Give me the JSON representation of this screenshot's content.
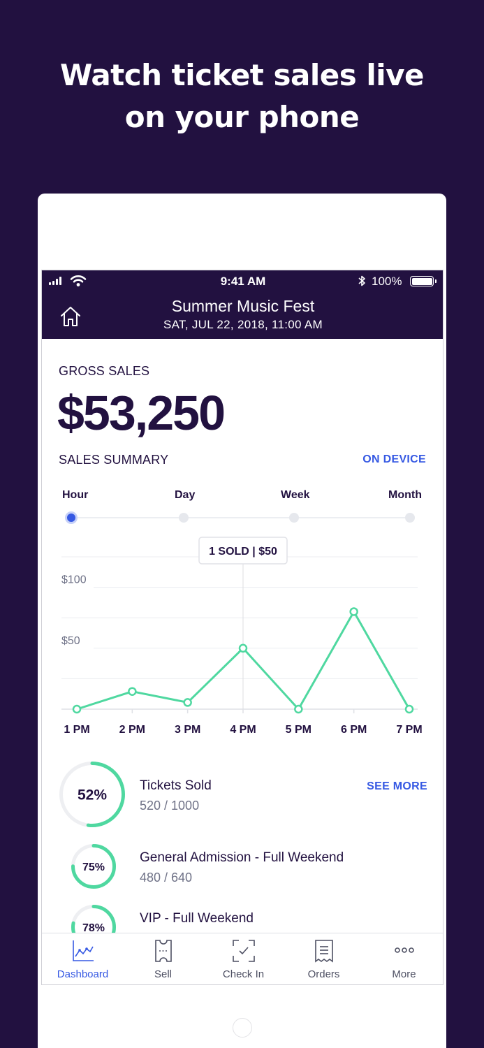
{
  "headline": {
    "line1": "Watch ticket sales live",
    "line2": "on your phone"
  },
  "status_bar": {
    "time": "9:41 AM",
    "battery": "100%"
  },
  "header": {
    "title": "Summer Music Fest",
    "date": "SAT, JUL 22, 2018, 11:00 AM"
  },
  "gross": {
    "label": "GROSS SALES",
    "value": "$53,250"
  },
  "summary": {
    "label": "SALES SUMMARY",
    "action": "ON DEVICE"
  },
  "ranges": [
    "Hour",
    "Day",
    "Week",
    "Month"
  ],
  "selected_range": "Hour",
  "tooltip": "1 SOLD | $50",
  "chart_data": {
    "type": "line",
    "categories": [
      "1 PM",
      "2 PM",
      "3 PM",
      "4 PM",
      "5 PM",
      "6 PM",
      "7 PM"
    ],
    "values": [
      0,
      29,
      11,
      100,
      0,
      160,
      0
    ],
    "yticks": [
      "$100",
      "$50"
    ],
    "ytick_values": [
      200,
      100
    ],
    "ylim": [
      0,
      250
    ],
    "grid": true,
    "line_color": "#4fd8a0",
    "highlight_index": 3
  },
  "tickets": {
    "title": "Tickets Sold",
    "count": "520 / 1000",
    "percent": "52%",
    "fraction": 0.52,
    "action": "SEE MORE",
    "types": [
      {
        "name": "General Admission - Full Weekend",
        "count": "480 / 640",
        "percent": "75%",
        "fraction": 0.75
      },
      {
        "name": "VIP - Full Weekend",
        "percent": "78%",
        "fraction": 0.78
      }
    ]
  },
  "colors": {
    "brand": "#221140",
    "accent": "#3659e3",
    "positive": "#4fd8a0"
  },
  "tabs": [
    {
      "label": "Dashboard",
      "icon": "chart-icon",
      "active": true
    },
    {
      "label": "Sell",
      "icon": "ticket-icon",
      "active": false
    },
    {
      "label": "Check In",
      "icon": "scan-icon",
      "active": false
    },
    {
      "label": "Orders",
      "icon": "receipt-icon",
      "active": false
    },
    {
      "label": "More",
      "icon": "more-icon",
      "active": false
    }
  ]
}
